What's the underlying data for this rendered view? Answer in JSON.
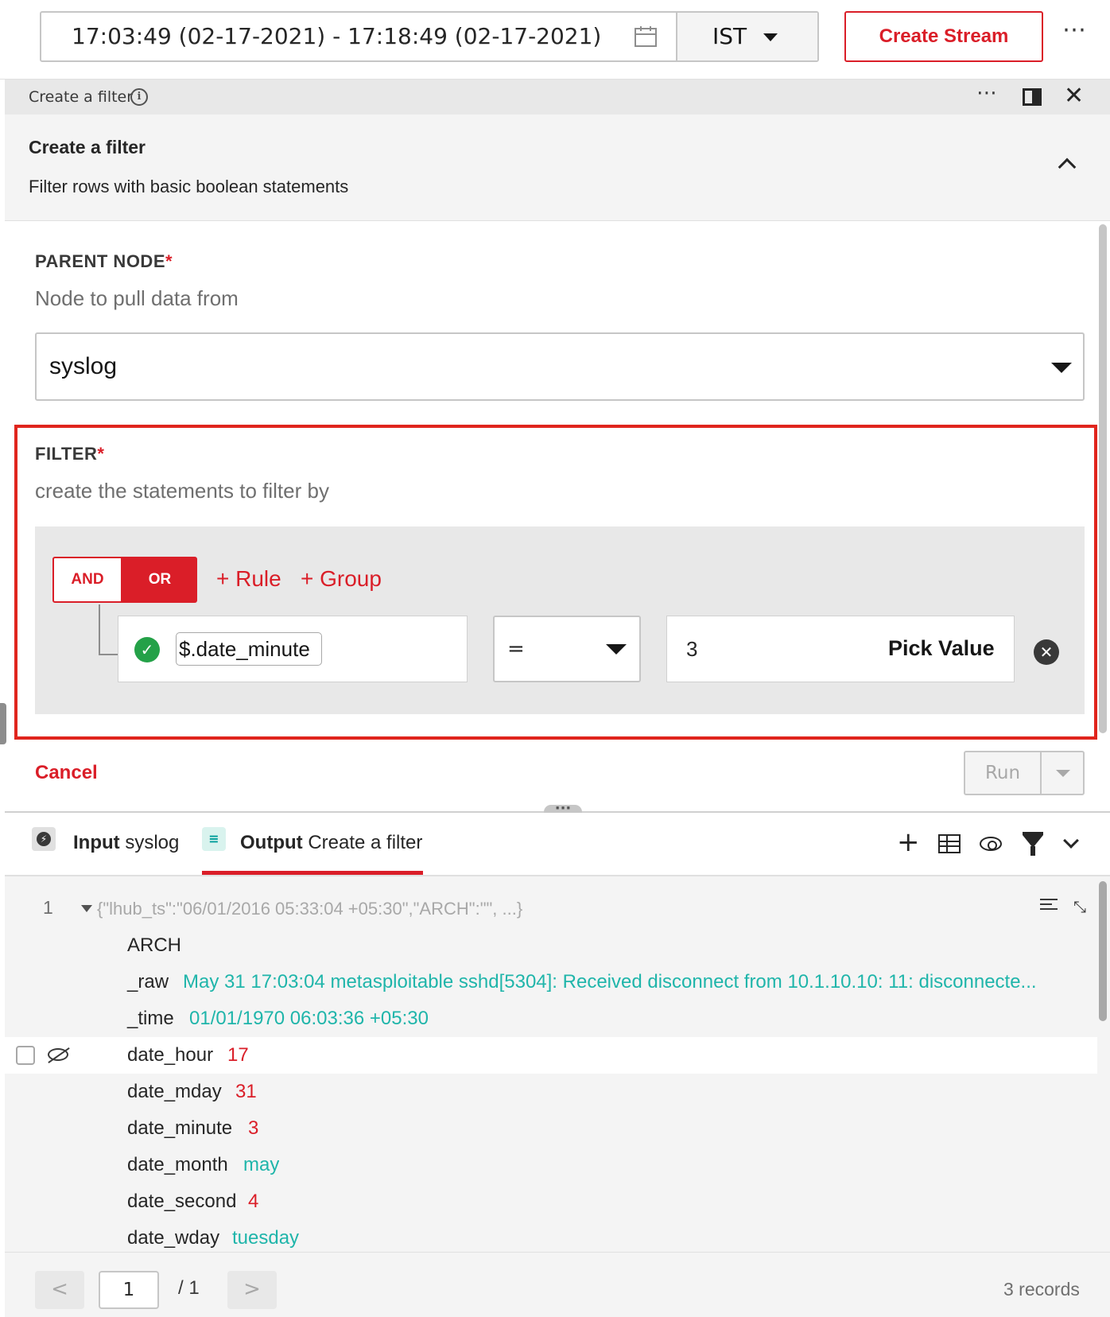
{
  "topbar": {
    "time_range": "17:03:49 (02-17-2021)   -   17:18:49 (02-17-2021)",
    "timezone": "IST",
    "create_stream_label": "Create Stream",
    "more_label": "⋯"
  },
  "panel": {
    "title": "Create a filter",
    "section_title": "Create a filter",
    "section_desc": "Filter rows with basic boolean statements"
  },
  "form": {
    "parent_node_label": "PARENT NODE",
    "parent_node_help": "Node to pull data from",
    "parent_node_value": "syslog",
    "filter_label": "FILTER",
    "filter_help": "create the statements to filter by",
    "required_mark": "*",
    "and_label": "AND",
    "or_label": "OR",
    "add_rule_label": "+ Rule",
    "add_group_label": "+ Group",
    "rule_field": "$.date_minute",
    "rule_operator": "=",
    "rule_value": "3",
    "pick_value_label": "Pick Value",
    "cancel_label": "Cancel",
    "run_label": "Run"
  },
  "tabs": {
    "input_label": "Input",
    "input_name": "syslog",
    "output_label": "Output",
    "output_name": "Create a filter"
  },
  "output": {
    "line_number": "1",
    "summary": "{\"lhub_ts\":\"06/01/2016 05:33:04 +05:30\",\"ARCH\":\"\", ...}",
    "rows": [
      {
        "key": "ARCH",
        "value": "",
        "color": "#1fb5aa"
      },
      {
        "key": "_raw",
        "value": "May 31 17:03:04 metasploitable sshd[5304]: Received disconnect from 10.1.10.10: 11: disconnecte...",
        "color": "#1fb5aa"
      },
      {
        "key": "_time",
        "value": "01/01/1970 06:03:36 +05:30",
        "color": "#1fb5aa"
      },
      {
        "key": "date_hour",
        "value": "17",
        "color": "#da1e28"
      },
      {
        "key": "date_mday",
        "value": "31",
        "color": "#da1e28"
      },
      {
        "key": "date_minute",
        "value": "3",
        "color": "#da1e28"
      },
      {
        "key": "date_month",
        "value": "may",
        "color": "#1fb5aa"
      },
      {
        "key": "date_second",
        "value": "4",
        "color": "#da1e28"
      },
      {
        "key": "date_wday",
        "value": "tuesday",
        "color": "#1fb5aa"
      }
    ]
  },
  "pagination": {
    "current_page": "1",
    "of_label": "/  1",
    "records_label": "3 records",
    "prev_label": "<",
    "next_label": ">"
  },
  "colors": {
    "accent": "#da1e28",
    "success": "#24a148",
    "teal_value": "#1fb5aa"
  }
}
